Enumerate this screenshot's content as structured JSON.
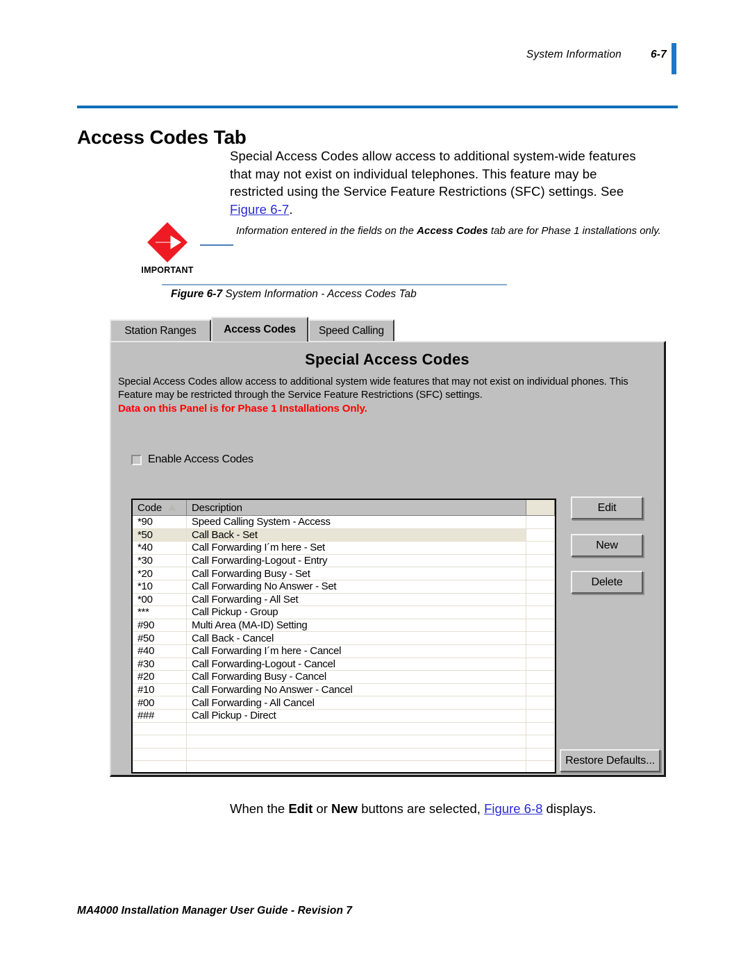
{
  "header": {
    "running_title": "System Information",
    "page_number": "6-7",
    "accent_color": "#1f76c4"
  },
  "title": "Access Codes Tab",
  "intro": {
    "line1": "Special Access Codes allow access to additional system-wide features",
    "line2": "that may not exist on individual telephones. This feature may be",
    "line3": "restricted using the Service Feature Restrictions (SFC) settings. See",
    "figure_link": "Figure 6-7",
    "period": "."
  },
  "important": {
    "label": "IMPORTANT",
    "text_before": "Information entered in the fields on the ",
    "text_bold": "Access Codes",
    "text_after": " tab are for Phase 1 installations only.",
    "icon_color": "#ee1b24"
  },
  "figure_caption": {
    "number": "Figure 6-7",
    "text": "System Information - Access Codes Tab"
  },
  "dialog": {
    "tabs": [
      {
        "label": "Station Ranges",
        "selected": false
      },
      {
        "label": "Access Codes",
        "selected": true
      },
      {
        "label": "Speed Calling",
        "selected": false
      }
    ],
    "panel_title": "Special Access Codes",
    "panel_description": "Special Access Codes allow access to additional system wide features that may not exist on individual phones.   This Feature may be restricted through the Service Feature Restrictions (SFC) settings.",
    "panel_warning": "Data on this Panel is for Phase 1 Installations Only.",
    "warning_color": "#ff0000",
    "enable_checkbox": {
      "label": "Enable Access Codes",
      "checked": false
    },
    "grid": {
      "columns": [
        "Code",
        "Description",
        ""
      ],
      "sort_column": "Code",
      "sort_direction": "ascending",
      "rows": [
        {
          "code": "*90",
          "description": "Speed Calling System - Access"
        },
        {
          "code": "*50",
          "description": "Call Back - Set"
        },
        {
          "code": "*40",
          "description": "Call Forwarding I´m here - Set"
        },
        {
          "code": "*30",
          "description": "Call Forwarding-Logout - Entry"
        },
        {
          "code": "*20",
          "description": "Call Forwarding Busy - Set"
        },
        {
          "code": "*10",
          "description": "Call Forwarding No Answer - Set"
        },
        {
          "code": "*00",
          "description": "Call Forwarding - All Set"
        },
        {
          "code": "***",
          "description": "Call Pickup - Group"
        },
        {
          "code": "#90",
          "description": "Multi Area (MA-ID) Setting"
        },
        {
          "code": "#50",
          "description": "Call Back - Cancel"
        },
        {
          "code": "#40",
          "description": "Call Forwarding I´m here - Cancel"
        },
        {
          "code": "#30",
          "description": "Call Forwarding-Logout - Cancel"
        },
        {
          "code": "#20",
          "description": "Call Forwarding Busy - Cancel"
        },
        {
          "code": "#10",
          "description": "Call Forwarding No Answer - Cancel"
        },
        {
          "code": "#00",
          "description": "Call Forwarding - All Cancel"
        },
        {
          "code": "###",
          "description": "Call Pickup - Direct"
        },
        {
          "code": "",
          "description": ""
        },
        {
          "code": "",
          "description": ""
        },
        {
          "code": "",
          "description": ""
        },
        {
          "code": "",
          "description": ""
        },
        {
          "code": "",
          "description": ""
        }
      ],
      "selected_row_index": 1
    },
    "buttons": {
      "edit": "Edit",
      "new": "New",
      "delete": "Delete",
      "restore": "Restore Defaults..."
    }
  },
  "closing": {
    "before": "When the ",
    "bold1": "Edit",
    "mid1": " or ",
    "bold2": "New",
    "mid2": " buttons are selected, ",
    "figure_link": "Figure 6-8",
    "after": " displays."
  },
  "footer": "MA4000 Installation Manager User Guide - Revision 7"
}
